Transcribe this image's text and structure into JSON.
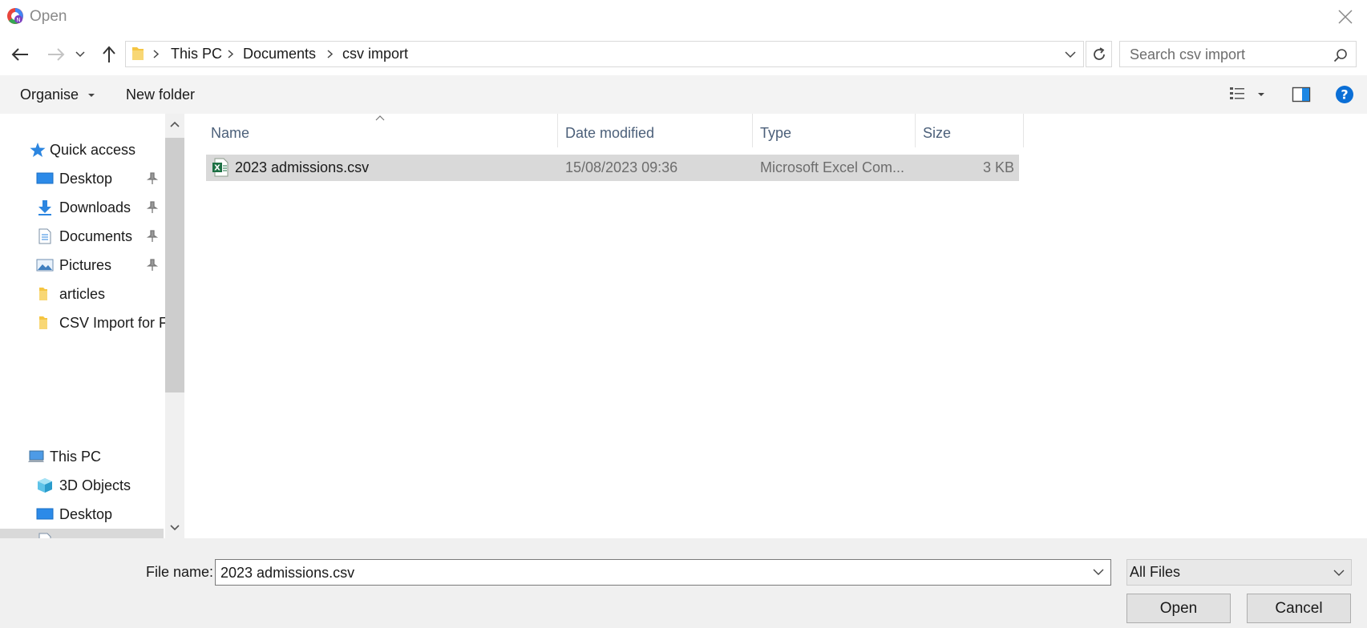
{
  "window": {
    "title": "Open"
  },
  "breadcrumb": [
    "This PC",
    "Documents",
    "csv import"
  ],
  "search": {
    "placeholder": "Search csv import"
  },
  "toolbar": {
    "organise": "Organise",
    "new_folder": "New folder"
  },
  "sidebar": {
    "quick_access": "Quick access",
    "quick_items": [
      {
        "label": "Desktop",
        "icon": "desktop-icon",
        "pinned": true
      },
      {
        "label": "Downloads",
        "icon": "downloads-icon",
        "pinned": true
      },
      {
        "label": "Documents",
        "icon": "documents-icon",
        "pinned": true
      },
      {
        "label": "Pictures",
        "icon": "pictures-icon",
        "pinned": true
      },
      {
        "label": "articles",
        "icon": "folder-icon",
        "pinned": false
      },
      {
        "label": "CSV Import for F",
        "icon": "folder-icon",
        "pinned": false
      }
    ],
    "this_pc": "This PC",
    "pc_items": [
      {
        "label": "3D Objects",
        "icon": "3d-objects-icon"
      },
      {
        "label": "Desktop",
        "icon": "desktop-icon"
      }
    ]
  },
  "columns": {
    "name": "Name",
    "date": "Date modified",
    "type": "Type",
    "size": "Size"
  },
  "files": [
    {
      "name": "2023 admissions.csv",
      "date": "15/08/2023 09:36",
      "type": "Microsoft Excel Com...",
      "size": "3 KB",
      "selected": true
    }
  ],
  "footer": {
    "file_name_label": "File name:",
    "file_name_value": "2023 admissions.csv",
    "filter": "All Files",
    "open": "Open",
    "cancel": "Cancel"
  },
  "colors": {
    "accent": "#1a73e8",
    "selection": "#d9d9d9",
    "help": "#0b6fd6"
  }
}
